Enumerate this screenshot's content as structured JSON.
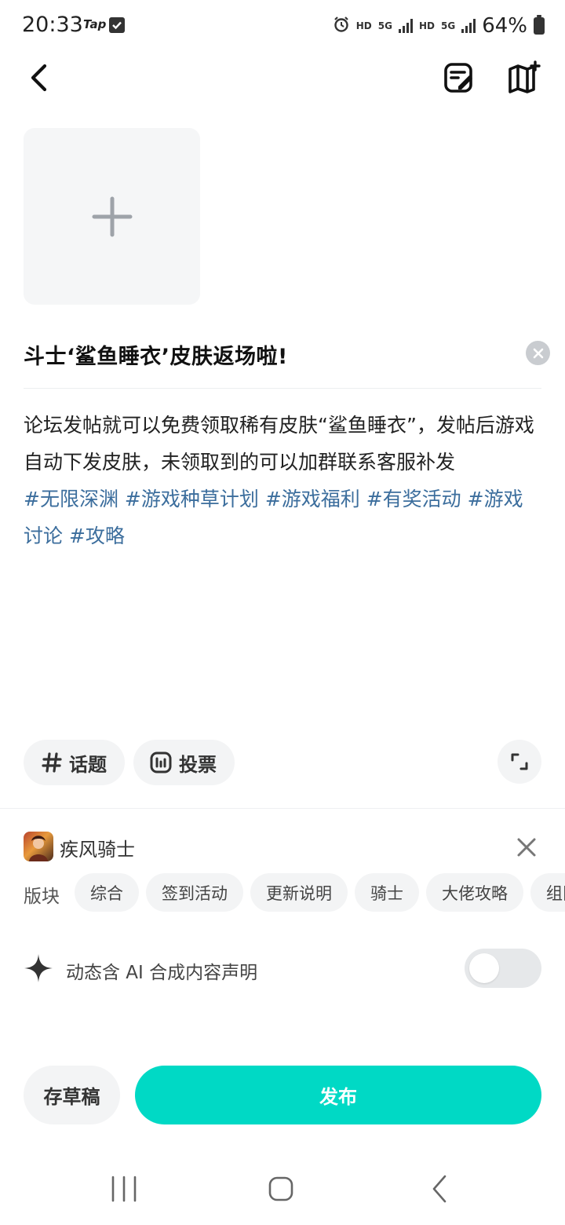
{
  "status_bar": {
    "time": "20:33",
    "app_badge": "Tap",
    "hd_1": "HD",
    "net_1": "5G",
    "hd_2": "HD",
    "net_2": "5G",
    "battery": "64%"
  },
  "header": {
    "back_icon": "chevron-left-icon",
    "draft_box_icon": "note-edit-icon",
    "guide_icon": "book-add-icon"
  },
  "post": {
    "title": "斗士‘鲨鱼睡衣’皮肤返场啦!",
    "body_text": "论坛发帖就可以免费领取稀有皮肤“鲨鱼睡衣”，发帖后游戏自动下发皮肤，未领取到的可以加群联系客服补发",
    "tags": [
      "#无限深渊",
      "#游戏种草计划",
      "#游戏福利",
      "#有奖活动",
      "#游戏讨论",
      "#攻略"
    ]
  },
  "tools": {
    "topic_label": "话题",
    "vote_label": "投票"
  },
  "game": {
    "name": "疾风骑士"
  },
  "board": {
    "label": "版块",
    "tags": [
      "综合",
      "签到活动",
      "更新说明",
      "骑士",
      "大佬攻略",
      "组队"
    ]
  },
  "ai": {
    "label": "动态含 AI 合成内容声明",
    "enabled": false
  },
  "actions": {
    "draft_label": "存草稿",
    "publish_label": "发布"
  },
  "colors": {
    "accent": "#00d9c5",
    "tag": "#3c6e9d"
  }
}
